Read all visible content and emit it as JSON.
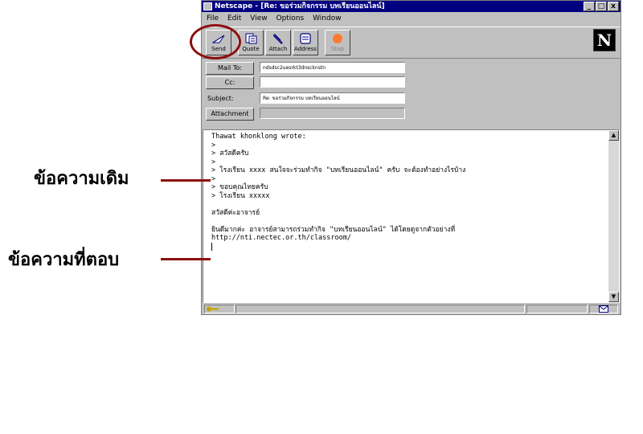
{
  "window": {
    "title": "Netscape - [Re: ขอร่วมกิจกรรม บทเรียนออนไลน์]",
    "min": "_",
    "restore": "□",
    "close": "x"
  },
  "menu": [
    "File",
    "Edit",
    "View",
    "Options",
    "Window"
  ],
  "toolbar": {
    "send": "Send",
    "quote": "Quote",
    "attach": "Attach",
    "address": "Address",
    "stop": "Stop",
    "logo": "N"
  },
  "fields": {
    "mail_to_label": "Mail To:",
    "mail_to_value": "ndsdsc2uesrkt3dnscknstn",
    "cc_label": "Cc:",
    "cc_value": "",
    "subject_label": "Subject:",
    "subject_value": "Re: ขอร่วมกิจกรรม บทเรียนออนไลน์",
    "attachment_label": "Attachment",
    "attachment_value": ""
  },
  "message_lines": [
    "Thawat khonklong wrote:",
    ">",
    "> สวัสดีครับ",
    ">",
    "> โรงเรียน xxxx สนใจจะร่วมทำกิจ \"บทเรียนออนไลน์\" ครับ จะต้องทำอย่างไรบ้าง",
    ">",
    "> ขอบคุณไทยครับ",
    "> โรงเรียน xxxxx",
    "",
    "สวัสดีค่ะอาจารย์",
    "",
    "ยินดีมากค่ะ อาจารย์สามารถร่วมทำกิจ \"บทเรียนออนไลน์\" ได้โดยดูจากตัวอย่างที่",
    "http://nti.nectec.or.th/classroom/"
  ],
  "annotations": {
    "original_message": "ข้อความเดิม",
    "reply_message": "ข้อความที่ตอบ"
  },
  "colors": {
    "title_bar": "#000080",
    "annotation_red": "#8b1010"
  }
}
